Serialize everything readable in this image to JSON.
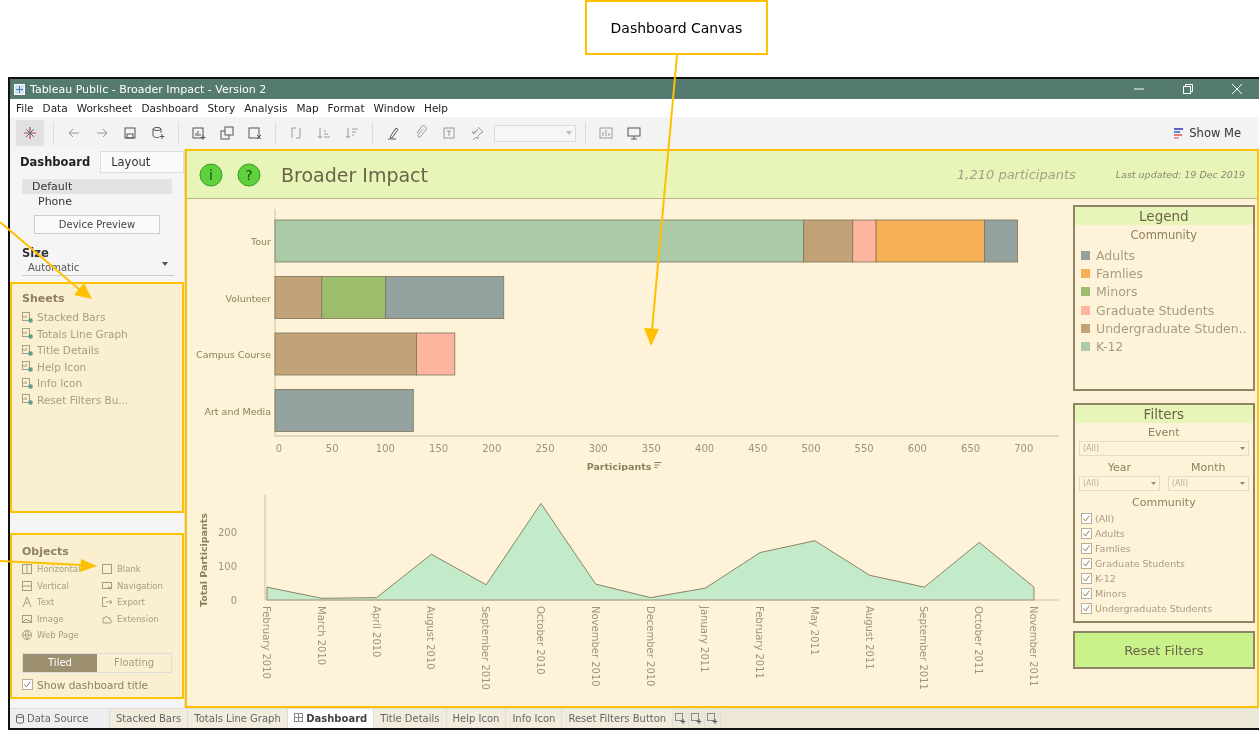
{
  "annotation": {
    "label": "Dashboard Canvas"
  },
  "window": {
    "title": "Tableau Public - Broader Impact - Version 2"
  },
  "menu": [
    "File",
    "Data",
    "Worksheet",
    "Dashboard",
    "Story",
    "Analysis",
    "Map",
    "Format",
    "Window",
    "Help"
  ],
  "toolbar": {
    "show_me": "Show Me"
  },
  "left_panel": {
    "tabs": [
      {
        "label": "Dashboard",
        "selected": true
      },
      {
        "label": "Layout",
        "selected": false
      }
    ],
    "devices": [
      {
        "label": "Default",
        "selected": true
      },
      {
        "label": "Phone",
        "selected": false
      }
    ],
    "device_preview": "Device Preview",
    "size": {
      "heading": "Size",
      "value": "Automatic"
    },
    "sheets": {
      "heading": "Sheets",
      "items": [
        "Stacked Bars",
        "Totals Line Graph",
        "Title Details",
        "Help Icon",
        "Info Icon",
        "Reset Filters Bu..."
      ]
    },
    "objects": {
      "heading": "Objects",
      "items": [
        {
          "label": "Horizontal",
          "kind": "horizontal"
        },
        {
          "label": "Blank",
          "kind": "blank"
        },
        {
          "label": "Vertical",
          "kind": "vertical"
        },
        {
          "label": "Navigation",
          "kind": "navigation"
        },
        {
          "label": "Text",
          "kind": "text"
        },
        {
          "label": "Export",
          "kind": "export"
        },
        {
          "label": "Image",
          "kind": "image"
        },
        {
          "label": "Extension",
          "kind": "extension"
        },
        {
          "label": "Web Page",
          "kind": "web"
        }
      ]
    },
    "layout_modes": [
      {
        "label": "Tiled",
        "selected": true
      },
      {
        "label": "Floating",
        "selected": false
      }
    ],
    "show_title": {
      "label": "Show dashboard title",
      "checked": true
    }
  },
  "dashboard": {
    "header": {
      "info_icon": "i",
      "help_icon": "?",
      "title": "Broader Impact",
      "participants": "1,210 participants",
      "updated": "Last updated:  19 Dec 2019"
    },
    "bar_chart": {
      "chart_data": {
        "type": "bar",
        "orientation": "horizontal",
        "stacked": true,
        "xlabel": "Participants",
        "categories": [
          "Tour",
          "Volunteer",
          "Campus Course",
          "Art and Media"
        ],
        "series": [
          {
            "color": "#aacaa8",
            "values": [
              497,
              null,
              null,
              null
            ]
          },
          {
            "color": "#c2a377",
            "values": [
              46,
              44,
              133,
              null
            ]
          },
          {
            "color": "#9bbd6c",
            "values": [
              null,
              60,
              null,
              null
            ]
          },
          {
            "color": "#fdb5a0",
            "values": [
              22,
              null,
              36,
              null
            ]
          },
          {
            "color": "#f5b056",
            "values": [
              102,
              null,
              null,
              null
            ]
          },
          {
            "color": "#93a29f",
            "values": [
              31,
              111,
              null,
              130
            ]
          }
        ],
        "xlim": [
          0,
          735
        ],
        "xticks": [
          0,
          50,
          100,
          150,
          200,
          250,
          300,
          350,
          400,
          450,
          500,
          550,
          600,
          650,
          700
        ]
      }
    },
    "area_chart": {
      "chart_data": {
        "type": "area",
        "ylabel": "Total Participants",
        "categories": [
          "February 2010",
          "March 2010",
          "April 2010",
          "August 2010",
          "September 2010",
          "October 2010",
          "November 2010",
          "December 2010",
          "January 2011",
          "February 2011",
          "May 2011",
          "August 2011",
          "September 2011",
          "October 2011",
          "November 2011"
        ],
        "series": [
          {
            "color": "#c3ebc9",
            "values": [
              38,
              5,
              7,
              135,
              45,
              285,
              47,
              7,
              35,
              140,
              175,
              73,
              38,
              170,
              38
            ]
          }
        ],
        "ylim": [
          0,
          310
        ],
        "yticks": [
          0,
          100,
          200
        ]
      }
    },
    "legend": {
      "title": "Legend",
      "subtitle": "Community",
      "items": [
        {
          "label": "Adults",
          "color": "#93a29f"
        },
        {
          "label": "Famlies",
          "color": "#f5b056"
        },
        {
          "label": "Minors",
          "color": "#9bbd6c"
        },
        {
          "label": "Graduate Students",
          "color": "#fdb5a0"
        },
        {
          "label": "Undergraduate Studen..",
          "color": "#c2a377"
        },
        {
          "label": "K-12",
          "color": "#aacaa8"
        }
      ]
    },
    "filters": {
      "title": "Filters",
      "event": {
        "label": "Event",
        "value": "(All)"
      },
      "year": {
        "label": "Year",
        "value": "(All)"
      },
      "month": {
        "label": "Month",
        "value": "(All)"
      },
      "community": {
        "label": "Community",
        "items": [
          {
            "label": "(All)",
            "checked": true
          },
          {
            "label": "Adults",
            "checked": true
          },
          {
            "label": "Famlies",
            "checked": true
          },
          {
            "label": "Graduate Students",
            "checked": true
          },
          {
            "label": "K-12",
            "checked": true
          },
          {
            "label": "Minors",
            "checked": true
          },
          {
            "label": "Undergraduate Students",
            "checked": true
          }
        ]
      }
    },
    "reset_button": "Reset Filters"
  },
  "sheet_tabs": {
    "data_source": "Data Source",
    "tabs": [
      {
        "label": "Stacked Bars",
        "selected": false
      },
      {
        "label": "Totals Line Graph",
        "selected": false
      },
      {
        "label": "Dashboard",
        "selected": true
      },
      {
        "label": "Title Details",
        "selected": false
      },
      {
        "label": "Help Icon",
        "selected": false
      },
      {
        "label": "Info Icon",
        "selected": false
      },
      {
        "label": "Reset Filters Button",
        "selected": false
      }
    ]
  }
}
